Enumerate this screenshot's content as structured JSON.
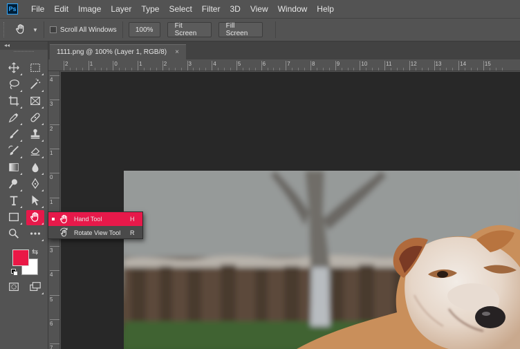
{
  "app": {
    "logo": "Ps"
  },
  "menu": [
    "File",
    "Edit",
    "Image",
    "Layer",
    "Type",
    "Select",
    "Filter",
    "3D",
    "View",
    "Window",
    "Help"
  ],
  "options_bar": {
    "scroll_all_windows": "Scroll All Windows",
    "zoom_button": "100%",
    "fit_screen": "Fit Screen",
    "fill_screen": "Fill Screen"
  },
  "document": {
    "tab_title": "1111.png @ 100% (Layer 1, RGB/8)",
    "close": "×"
  },
  "rulers": {
    "top_labels": [
      "2",
      "1",
      "0",
      "1",
      "2",
      "3",
      "4",
      "5",
      "6",
      "7",
      "8",
      "9",
      "10",
      "11",
      "12",
      "13",
      "14",
      "15"
    ],
    "left_labels": [
      "4",
      "3",
      "2",
      "1",
      "0",
      "1",
      "2",
      "3",
      "4",
      "5",
      "6",
      "7"
    ]
  },
  "colors": {
    "foreground": "#ea1846",
    "background": "#ffffff",
    "accent": "#e7194a"
  },
  "toolbar_panel": {
    "collapse": "◂◂"
  },
  "flyout": {
    "items": [
      {
        "label": "Hand Tool",
        "shortcut": "H",
        "selected": true
      },
      {
        "label": "Rotate View Tool",
        "shortcut": "R",
        "selected": false
      }
    ]
  }
}
